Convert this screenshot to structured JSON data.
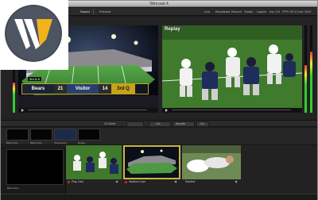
{
  "window": {
    "title": "Wirecast 4"
  },
  "toolbar": {
    "items": [
      "Sound",
      "Preview",
      "Live",
      "Broadcast",
      "Record",
      "Studio",
      "Layers",
      "Ins: 0.0",
      "FPS: 30.0",
      "Live: 00:0"
    ]
  },
  "preview": {
    "scoreboard": {
      "home": "Bears",
      "home_score": "21",
      "visitor": "Visitor",
      "visitor_score": "14",
      "quarter": "3rd Q",
      "down": "3rd & 6"
    }
  },
  "program": {
    "label": "Replay"
  },
  "transition": {
    "mode_label": "Go Mode",
    "cut_label": "Cut",
    "smooth_label": "Smooth",
    "go_label": "Go"
  },
  "bins": {
    "top_row": [
      {
        "caption": "Blank Shot"
      },
      {
        "caption": "Blank Shot"
      },
      {
        "caption": "Scoreboard"
      },
      {
        "caption": "Replay"
      }
    ],
    "blank_caption": "Blank Shot",
    "media": [
      {
        "caption": "Play Cam"
      },
      {
        "caption": "Stadium Cam"
      },
      {
        "caption": "Sideline"
      }
    ]
  },
  "colors": {
    "accent_selected": "#c9b640",
    "record": "#d62828",
    "brand_logo": "#f3b21b"
  },
  "meters": {
    "preview_left_level": 0.35,
    "program_right_level": 0.55,
    "far_right_level": 0.7
  }
}
